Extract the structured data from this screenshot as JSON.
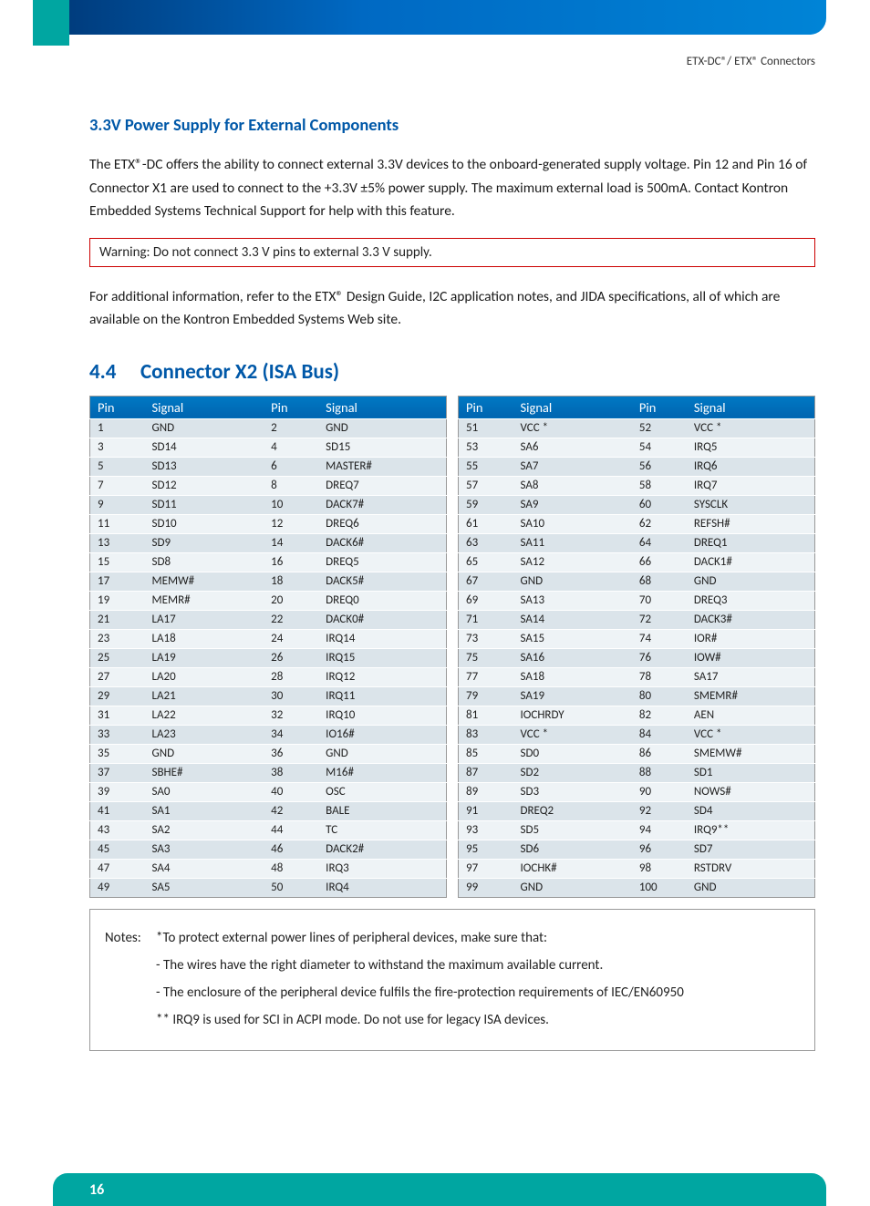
{
  "header": {
    "right_text": "ETX-DC®/ ETX® Connectors"
  },
  "sec1": {
    "title": "3.3V Power Supply for External Components",
    "p1": "The ETX®-DC offers the ability to connect external 3.3V devices to the onboard-generated supply voltage. Pin 12 and Pin 16 of Connector X1 are used to connect to the +3.3V ±5% power supply. The maximum external load is 500mA. Contact Kontron Embedded Systems Technical Support for help with this feature.",
    "warning": "Warning: Do not connect 3.3 V pins to external 3.3 V supply.",
    "p2": "For additional information, refer to the ETX® Design Guide, I2C application notes, and JIDA specifications, all of which are available on the Kontron Embedded Systems Web site."
  },
  "sec2": {
    "num": "4.4",
    "title": "Connector X2 (ISA Bus)",
    "th_pin": "Pin",
    "th_signal": "Signal",
    "left_rows": [
      {
        "p1": "1",
        "s1": "GND",
        "p2": "2",
        "s2": "GND"
      },
      {
        "p1": "3",
        "s1": "SD14",
        "p2": "4",
        "s2": "SD15"
      },
      {
        "p1": "5",
        "s1": "SD13",
        "p2": "6",
        "s2": "MASTER#"
      },
      {
        "p1": "7",
        "s1": "SD12",
        "p2": "8",
        "s2": "DREQ7"
      },
      {
        "p1": "9",
        "s1": "SD11",
        "p2": "10",
        "s2": "DACK7#"
      },
      {
        "p1": "11",
        "s1": "SD10",
        "p2": "12",
        "s2": "DREQ6"
      },
      {
        "p1": "13",
        "s1": "SD9",
        "p2": "14",
        "s2": "DACK6#"
      },
      {
        "p1": "15",
        "s1": "SD8",
        "p2": "16",
        "s2": "DREQ5"
      },
      {
        "p1": "17",
        "s1": "MEMW#",
        "p2": "18",
        "s2": "DACK5#"
      },
      {
        "p1": "19",
        "s1": "MEMR#",
        "p2": "20",
        "s2": "DREQ0"
      },
      {
        "p1": "21",
        "s1": "LA17",
        "p2": "22",
        "s2": "DACK0#"
      },
      {
        "p1": "23",
        "s1": "LA18",
        "p2": "24",
        "s2": "IRQ14"
      },
      {
        "p1": "25",
        "s1": "LA19",
        "p2": "26",
        "s2": "IRQ15"
      },
      {
        "p1": "27",
        "s1": "LA20",
        "p2": "28",
        "s2": "IRQ12"
      },
      {
        "p1": "29",
        "s1": "LA21",
        "p2": "30",
        "s2": "IRQ11"
      },
      {
        "p1": "31",
        "s1": "LA22",
        "p2": "32",
        "s2": "IRQ10"
      },
      {
        "p1": "33",
        "s1": "LA23",
        "p2": "34",
        "s2": "IO16#"
      },
      {
        "p1": "35",
        "s1": "GND",
        "p2": "36",
        "s2": "GND"
      },
      {
        "p1": "37",
        "s1": "SBHE#",
        "p2": "38",
        "s2": "M16#"
      },
      {
        "p1": "39",
        "s1": "SA0",
        "p2": "40",
        "s2": "OSC"
      },
      {
        "p1": "41",
        "s1": "SA1",
        "p2": "42",
        "s2": "BALE"
      },
      {
        "p1": "43",
        "s1": "SA2",
        "p2": "44",
        "s2": "TC"
      },
      {
        "p1": "45",
        "s1": "SA3",
        "p2": "46",
        "s2": "DACK2#"
      },
      {
        "p1": "47",
        "s1": "SA4",
        "p2": "48",
        "s2": "IRQ3"
      },
      {
        "p1": "49",
        "s1": "SA5",
        "p2": "50",
        "s2": "IRQ4"
      }
    ],
    "right_rows": [
      {
        "p1": "51",
        "s1": "VCC *",
        "p2": "52",
        "s2": "VCC *"
      },
      {
        "p1": "53",
        "s1": "SA6",
        "p2": "54",
        "s2": "IRQ5"
      },
      {
        "p1": "55",
        "s1": "SA7",
        "p2": "56",
        "s2": "IRQ6"
      },
      {
        "p1": "57",
        "s1": "SA8",
        "p2": "58",
        "s2": "IRQ7"
      },
      {
        "p1": "59",
        "s1": "SA9",
        "p2": "60",
        "s2": "SYSCLK"
      },
      {
        "p1": "61",
        "s1": "SA10",
        "p2": "62",
        "s2": "REFSH#"
      },
      {
        "p1": "63",
        "s1": "SA11",
        "p2": "64",
        "s2": "DREQ1"
      },
      {
        "p1": "65",
        "s1": "SA12",
        "p2": "66",
        "s2": "DACK1#"
      },
      {
        "p1": "67",
        "s1": "GND",
        "p2": "68",
        "s2": "GND"
      },
      {
        "p1": "69",
        "s1": "SA13",
        "p2": "70",
        "s2": "DREQ3"
      },
      {
        "p1": "71",
        "s1": "SA14",
        "p2": "72",
        "s2": "DACK3#"
      },
      {
        "p1": "73",
        "s1": "SA15",
        "p2": "74",
        "s2": "IOR#"
      },
      {
        "p1": "75",
        "s1": "SA16",
        "p2": "76",
        "s2": "IOW#"
      },
      {
        "p1": "77",
        "s1": "SA18",
        "p2": "78",
        "s2": "SA17"
      },
      {
        "p1": "79",
        "s1": "SA19",
        "p2": "80",
        "s2": "SMEMR#"
      },
      {
        "p1": "81",
        "s1": "IOCHRDY",
        "p2": "82",
        "s2": "AEN"
      },
      {
        "p1": "83",
        "s1": "VCC *",
        "p2": "84",
        "s2": "VCC *"
      },
      {
        "p1": "85",
        "s1": "SD0",
        "p2": "86",
        "s2": "SMEMW#"
      },
      {
        "p1": "87",
        "s1": "SD2",
        "p2": "88",
        "s2": "SD1"
      },
      {
        "p1": "89",
        "s1": "SD3",
        "p2": "90",
        "s2": "NOWS#"
      },
      {
        "p1": "91",
        "s1": "DREQ2",
        "p2": "92",
        "s2": "SD4"
      },
      {
        "p1": "93",
        "s1": "SD5",
        "p2": "94",
        "s2": "IRQ9**"
      },
      {
        "p1": "95",
        "s1": "SD6",
        "p2": "96",
        "s2": "SD7"
      },
      {
        "p1": "97",
        "s1": "IOCHK#",
        "p2": "98",
        "s2": "RSTDRV"
      },
      {
        "p1": "99",
        "s1": "GND",
        "p2": "100",
        "s2": "GND"
      }
    ]
  },
  "notes": {
    "label": "Notes:",
    "l1": "*To protect external power lines of peripheral devices, make sure that:",
    "l2": "- The wires have the right diameter to withstand the maximum available current.",
    "l3": "- The enclosure of the peripheral device fulfils the fire-protection requirements of IEC/EN60950",
    "l4": "** IRQ9 is used for SCI in ACPI mode. Do not use for legacy ISA devices."
  },
  "footer": {
    "page": "16"
  }
}
